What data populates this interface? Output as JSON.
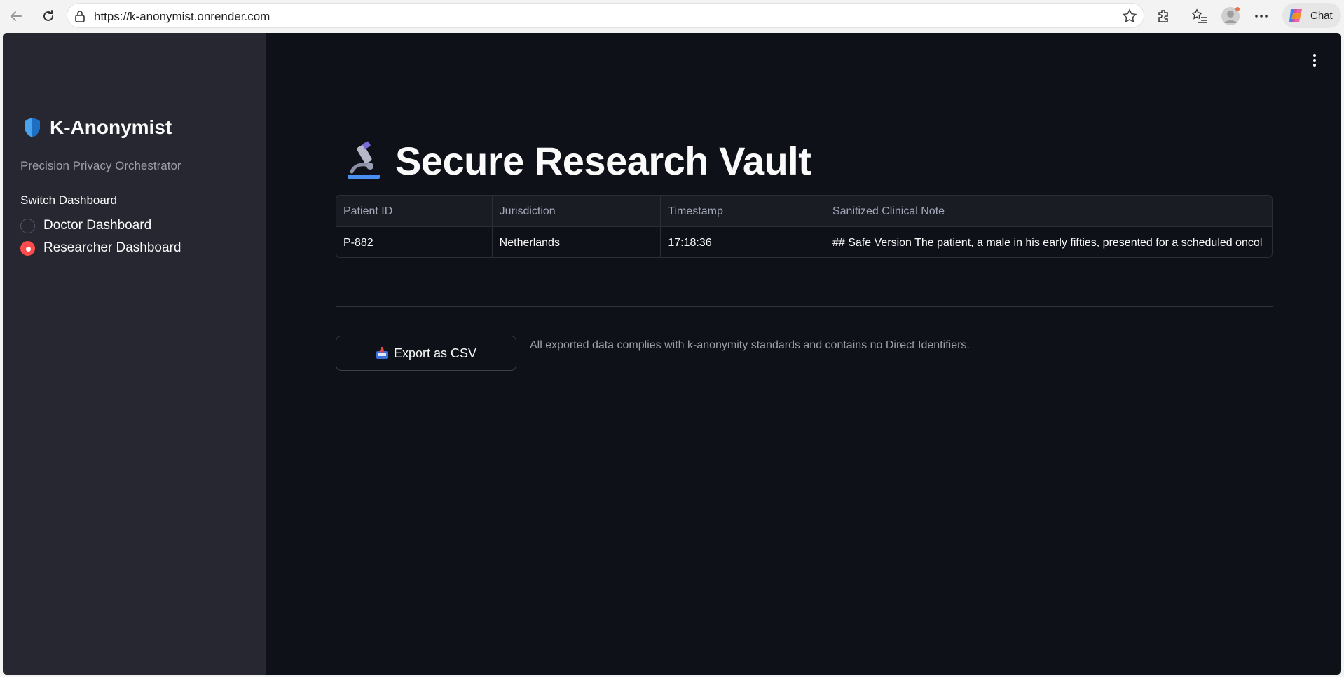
{
  "browser": {
    "url": "https://k-anonymist.onrender.com",
    "chat_label": "Chat"
  },
  "sidebar": {
    "brand_title": "K-Anonymist",
    "brand_subtitle": "Precision Privacy Orchestrator",
    "switch_label": "Switch Dashboard",
    "options": [
      {
        "label": "Doctor Dashboard",
        "selected": false
      },
      {
        "label": "Researcher Dashboard",
        "selected": true
      }
    ]
  },
  "main": {
    "title": "Secure Research Vault",
    "title_icon": "microscope-icon",
    "table": {
      "columns": [
        "Patient ID",
        "Jurisdiction",
        "Timestamp",
        "Sanitized Clinical Note"
      ],
      "rows": [
        [
          "P-882",
          "Netherlands",
          "17:18:36",
          "## Safe Version  The patient, a male in his early fifties, presented for a scheduled oncol"
        ]
      ]
    },
    "export_label": "Export as CSV",
    "export_icon": "inbox-tray-icon",
    "export_note": "All exported data complies with k-anonymity standards and contains no Direct Identifiers."
  },
  "colors": {
    "accent": "#ff4b4b",
    "app_bg": "#0e1117",
    "sidebar_bg": "#262730"
  }
}
